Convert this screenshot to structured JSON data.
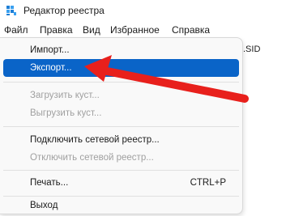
{
  "window": {
    "title": "Редактор реестра",
    "icon": "registry-editor-icon"
  },
  "menubar": {
    "file": "Файл",
    "edit": "Правка",
    "view": "Вид",
    "favorites": "Избранное",
    "help": "Справка"
  },
  "background": {
    "column_header_partial": ".SID"
  },
  "file_menu": {
    "items": [
      {
        "label": "Импорт...",
        "enabled": true
      },
      {
        "label": "Экспорт...",
        "enabled": true,
        "highlighted": true
      },
      {
        "label": "Загрузить куст...",
        "enabled": false
      },
      {
        "label": "Выгрузить куст...",
        "enabled": false
      },
      {
        "label": "Подключить сетевой реестр...",
        "enabled": true
      },
      {
        "label": "Отключить сетевой реестр...",
        "enabled": false
      },
      {
        "label": "Печать...",
        "enabled": true,
        "shortcut": "CTRL+P"
      },
      {
        "label": "Выход",
        "enabled": true
      }
    ]
  },
  "annotation": {
    "arrow_color": "#e8201c"
  },
  "colors": {
    "highlight": "#0a64c8",
    "disabled_text": "#a0a0a0"
  }
}
